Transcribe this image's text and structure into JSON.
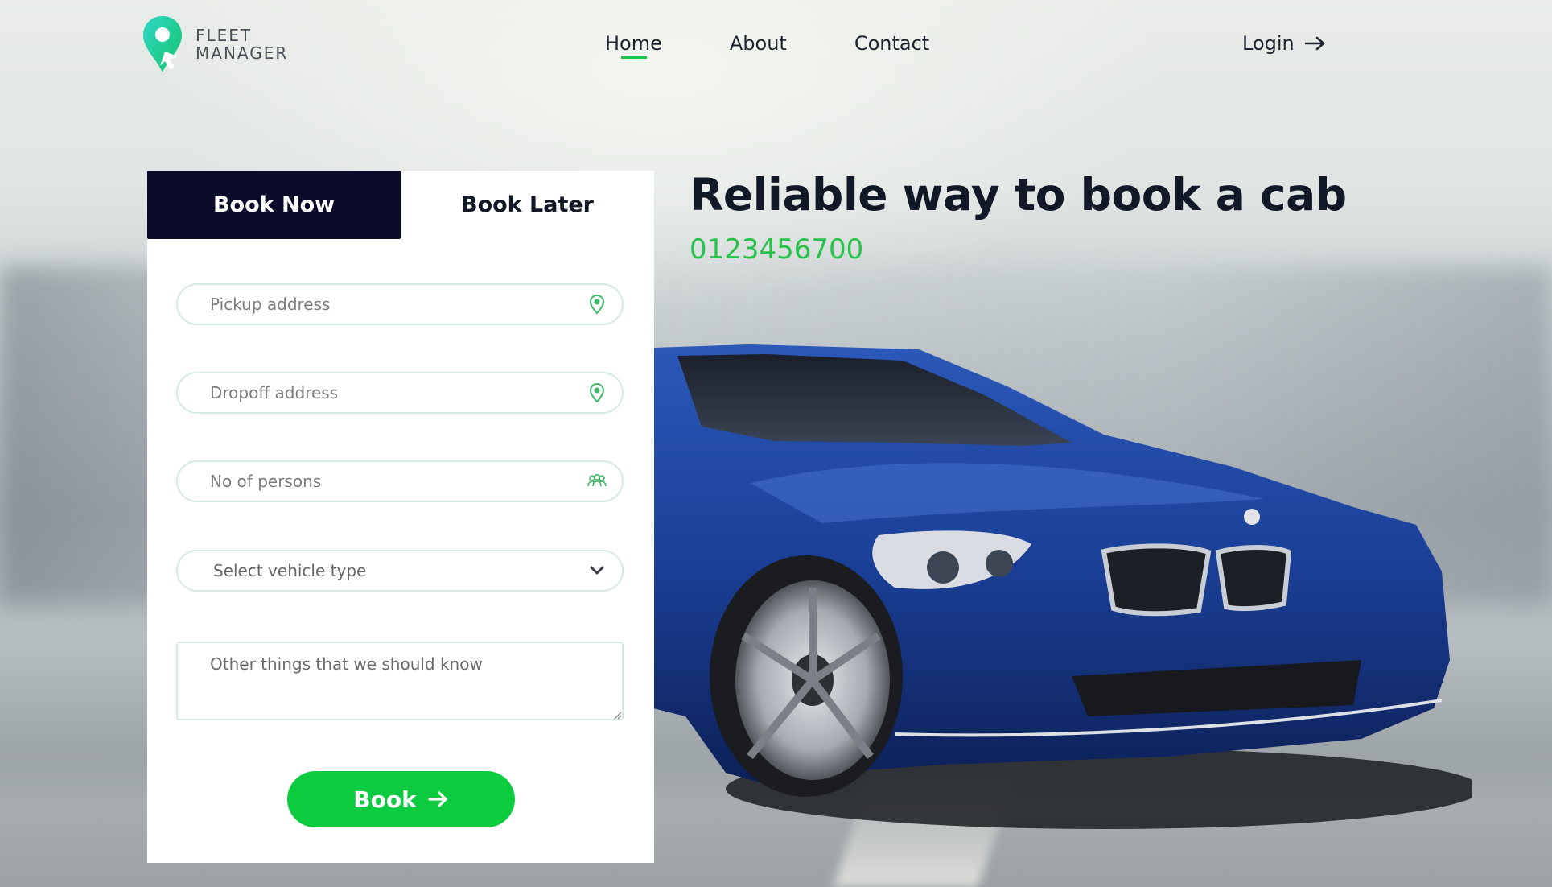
{
  "brand": {
    "line1": "FLEET",
    "line2": "MANAGER"
  },
  "nav": {
    "items": [
      {
        "label": "Home",
        "active": true
      },
      {
        "label": "About",
        "active": false
      },
      {
        "label": "Contact",
        "active": false
      }
    ],
    "login_label": "Login"
  },
  "hero": {
    "headline": "Reliable way to book a cab",
    "phone": "0123456700"
  },
  "booking": {
    "tabs": {
      "now": "Book Now",
      "later": "Book Later"
    },
    "pickup_placeholder": "Pickup address",
    "dropoff_placeholder": "Dropoff address",
    "persons_placeholder": "No of persons",
    "vehicle_select": "Select vehicle type",
    "notes_placeholder": "Other things that we should know",
    "submit_label": "Book"
  },
  "colors": {
    "accent_green": "#0ccb3f",
    "tab_dark": "#0b0b2a",
    "car_blue": "#1b3f96"
  },
  "icons": [
    "location-pin-icon",
    "users-icon",
    "chevron-down-icon",
    "arrow-right-icon"
  ]
}
